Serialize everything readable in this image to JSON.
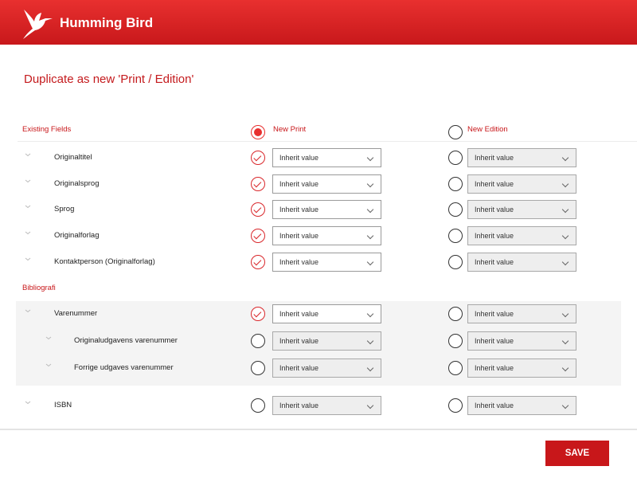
{
  "app": {
    "title": "Humming Bird",
    "logo": "hummingbird-logo"
  },
  "page": {
    "title": "Duplicate as new 'Print / Edition'"
  },
  "columns": {
    "fields": "Existing Fields",
    "print": "New Print",
    "edition": "New Edition",
    "print_header_selected": true,
    "edition_header_selected": false
  },
  "sections": {
    "bibliografi": "Bibliografi"
  },
  "rows": [
    {
      "label": "Originaltitel",
      "print_checked": true,
      "print_value": "Inherit value",
      "edition_checked": false,
      "edition_value": "Inherit value"
    },
    {
      "label": "Originalsprog",
      "print_checked": true,
      "print_value": "Inherit value",
      "edition_checked": false,
      "edition_value": "Inherit value"
    },
    {
      "label": "Sprog",
      "print_checked": true,
      "print_value": "Inherit value",
      "edition_checked": false,
      "edition_value": "Inherit value"
    },
    {
      "label": "Originalforlag",
      "print_checked": true,
      "print_value": "Inherit value",
      "edition_checked": false,
      "edition_value": "Inherit value"
    },
    {
      "label": "Kontaktperson (Originalforlag)",
      "print_checked": true,
      "print_value": "Inherit value",
      "edition_checked": false,
      "edition_value": "Inherit value"
    },
    {
      "label": "Varenummer",
      "print_checked": true,
      "print_value": "Inherit value",
      "edition_checked": false,
      "edition_value": "Inherit value"
    },
    {
      "label": "Originaludgavens varenummer",
      "print_checked": false,
      "print_value": "Inherit value",
      "edition_checked": false,
      "edition_value": "Inherit value"
    },
    {
      "label": "Forrige udgaves varenummer",
      "print_checked": false,
      "print_value": "Inherit value",
      "edition_checked": false,
      "edition_value": "Inherit value"
    },
    {
      "label": "ISBN",
      "print_checked": false,
      "print_value": "Inherit value",
      "edition_checked": false,
      "edition_value": "Inherit value"
    }
  ],
  "footer": {
    "save_label": "SAVE"
  },
  "colors": {
    "accent": "#c8171a",
    "header": "#e8302f"
  }
}
